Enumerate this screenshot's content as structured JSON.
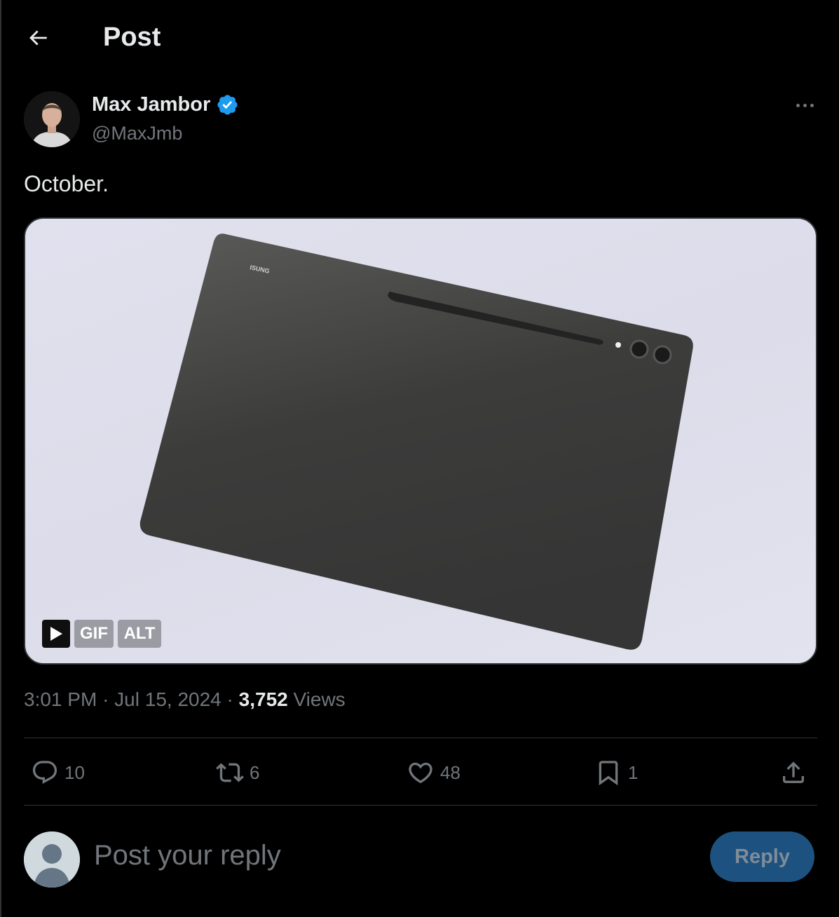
{
  "header": {
    "title": "Post",
    "back_icon": "arrow-left-icon"
  },
  "post": {
    "author": {
      "name": "Max Jambor",
      "handle": "@MaxJmb",
      "verified": true,
      "verified_color": "#1d9bf0"
    },
    "text": "October.",
    "media": {
      "type": "GIF",
      "badges": {
        "gif": "GIF",
        "alt": "ALT"
      },
      "brand_text": "ISUNG"
    },
    "time": "3:01 PM",
    "date": "Jul 15, 2024",
    "views_count": "3,752",
    "views_label": "Views",
    "separator": "·"
  },
  "actions": {
    "replies": "10",
    "reposts": "6",
    "likes": "48",
    "bookmarks": "1"
  },
  "reply_box": {
    "placeholder": "Post your reply",
    "button_label": "Reply",
    "button_color": "#1d5280"
  },
  "colors": {
    "background": "#000000",
    "text": "#e7e9ea",
    "muted": "#71767b",
    "border": "#2f3336"
  }
}
